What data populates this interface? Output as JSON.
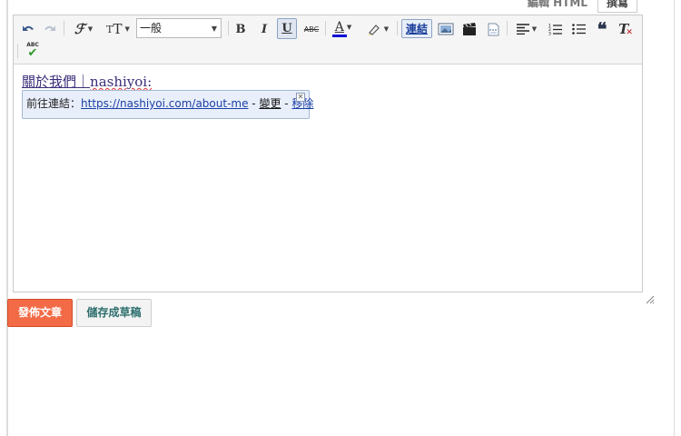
{
  "tabs": {
    "html_label": "編輯 HTML",
    "compose_label": "撰寫"
  },
  "toolbar": {
    "undo_icon": "undo-icon",
    "redo_icon": "redo-icon",
    "font_family_icon": "font-family-icon",
    "font_size_icon": "font-size-icon",
    "format_select_value": "一般",
    "bold_label": "B",
    "italic_label": "I",
    "underline_label": "U",
    "strikethrough_label": "ABC",
    "text_color_label": "A",
    "text_color_bar": "#1212d6",
    "highlight_icon": "highlight-pen-icon",
    "link_label": "連結",
    "image_icon": "image-icon",
    "video_icon": "video-icon",
    "jump_break_icon": "jump-break-icon",
    "align_icon": "align-icon",
    "numbered_list_icon": "numbered-list-icon",
    "bulleted_list_icon": "bulleted-list-icon",
    "quote_icon": "quote-icon",
    "clear_format_label": "T",
    "spellcheck_label": "ABC"
  },
  "editor": {
    "content_linked": "關於我們",
    "content_separator": "｜",
    "content_rest": "nashiyoi:"
  },
  "link_bubble": {
    "prefix": "前往連結：",
    "url": "https://nashiyoi.com/about-me",
    "dash1": " - ",
    "change_label": "變更",
    "dash2": " - ",
    "remove_label": "移除",
    "close_glyph": "✕"
  },
  "buttons": {
    "publish_label": "發佈文章",
    "save_draft_label": "儲存成草稿"
  },
  "colors": {
    "accent_publish": "#f26b46",
    "draft_text": "#2d6f6d"
  }
}
